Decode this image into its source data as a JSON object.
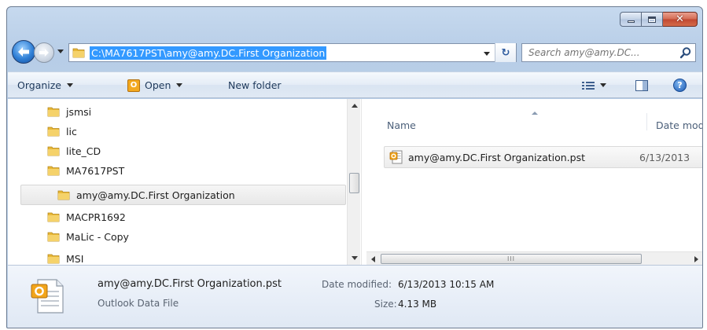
{
  "window": {
    "caption_buttons": {
      "minimize": "minimize",
      "maximize": "maximize",
      "close": "✕"
    }
  },
  "address_bar": {
    "path": "C:\\MA7617PST\\amy@amy.DC.First Organization",
    "refresh_glyph": "↻"
  },
  "search": {
    "placeholder": "Search amy@amy.DC..."
  },
  "toolbar": {
    "organize_label": "Organize",
    "open_label": "Open",
    "open_icon_letter": "O",
    "new_folder_label": "New folder",
    "help_glyph": "?"
  },
  "nav_tree": {
    "items": [
      {
        "label": "jsmsi",
        "indent": 0,
        "selected": false
      },
      {
        "label": "lic",
        "indent": 0,
        "selected": false
      },
      {
        "label": "lite_CD",
        "indent": 0,
        "selected": false
      },
      {
        "label": "MA7617PST",
        "indent": 0,
        "selected": false
      },
      {
        "label": "amy@amy.DC.First Organization",
        "indent": 1,
        "selected": true
      },
      {
        "label": "MACPR1692",
        "indent": 0,
        "selected": false
      },
      {
        "label": "MaLic - Copy",
        "indent": 0,
        "selected": false
      },
      {
        "label": "MSI",
        "indent": 0,
        "selected": false
      }
    ]
  },
  "file_list": {
    "columns": {
      "name": "Name",
      "date": "Date mod"
    },
    "files": [
      {
        "name": "amy@amy.DC.First Organization.pst",
        "date": "6/13/2013"
      }
    ],
    "hscroll_grip": "III"
  },
  "details": {
    "file_name": "amy@amy.DC.First Organization.pst",
    "file_type": "Outlook Data File",
    "modified_label": "Date modified:",
    "modified_value": "6/13/2013 10:15 AM",
    "size_label": "Size:",
    "size_value": "4.13 MB"
  },
  "colors": {
    "selection": "#3399ff",
    "frame": "#b7cde7",
    "folder": "#e8b838"
  },
  "icons": {
    "back": "back-arrow-icon",
    "forward": "forward-arrow-icon",
    "folder": "folder-icon",
    "search": "search-icon",
    "pst_file": "outlook-pst-file-icon",
    "help": "help-icon"
  }
}
